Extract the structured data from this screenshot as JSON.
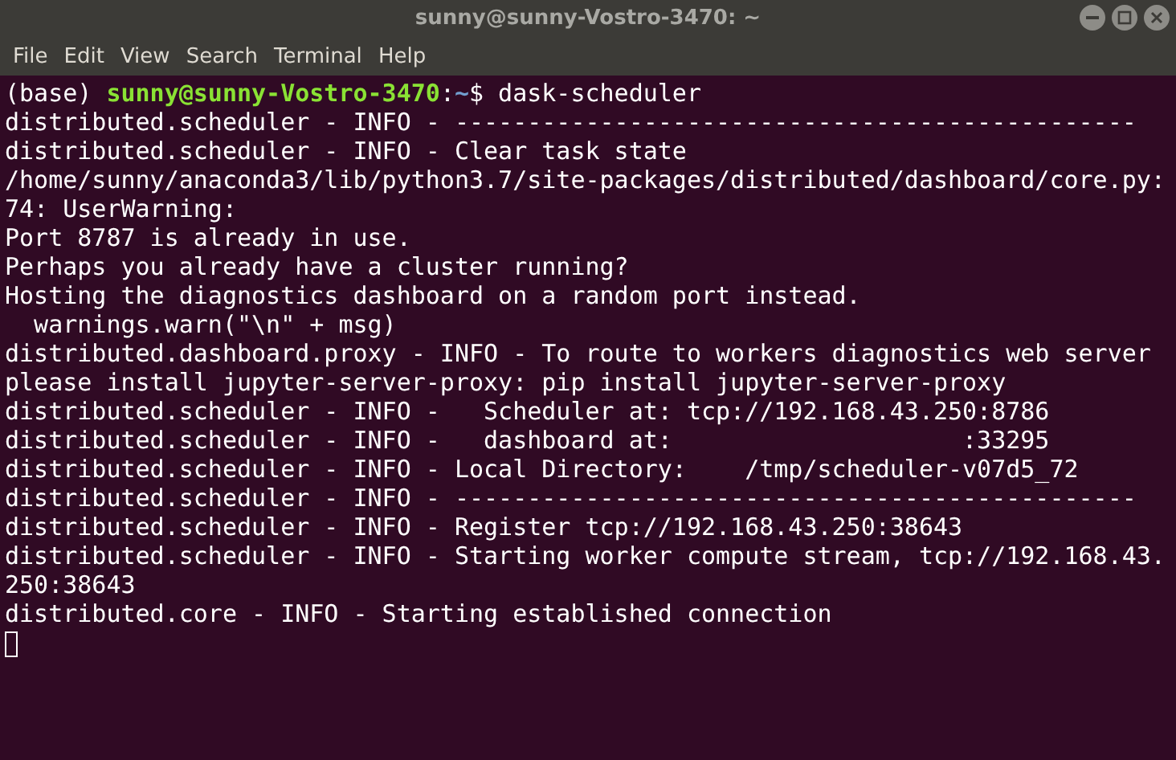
{
  "window": {
    "title": "sunny@sunny-Vostro-3470: ~"
  },
  "menu": [
    "File",
    "Edit",
    "View",
    "Search",
    "Terminal",
    "Help"
  ],
  "terminal": {
    "prompt": [
      {
        "kind": "plain",
        "text": "(base) "
      },
      {
        "kind": "user",
        "text": "sunny@sunny-Vostro-3470"
      },
      {
        "kind": "plain",
        "text": ":"
      },
      {
        "kind": "path",
        "text": "~"
      },
      {
        "kind": "plain",
        "text": "$ dask-scheduler"
      }
    ],
    "lines": [
      "distributed.scheduler - INFO - -----------------------------------------------",
      "distributed.scheduler - INFO - Clear task state",
      "/home/sunny/anaconda3/lib/python3.7/site-packages/distributed/dashboard/core.py:",
      "74: UserWarning:",
      "Port 8787 is already in use.",
      "Perhaps you already have a cluster running?",
      "Hosting the diagnostics dashboard on a random port instead.",
      "  warnings.warn(\"\\n\" + msg)",
      "distributed.dashboard.proxy - INFO - To route to workers diagnostics web server",
      "please install jupyter-server-proxy: pip install jupyter-server-proxy",
      "distributed.scheduler - INFO -   Scheduler at: tcp://192.168.43.250:8786",
      "distributed.scheduler - INFO -   dashboard at:                    :33295",
      "distributed.scheduler - INFO - Local Directory:    /tmp/scheduler-v07d5_72",
      "distributed.scheduler - INFO - -----------------------------------------------",
      "distributed.scheduler - INFO - Register tcp://192.168.43.250:38643",
      "distributed.scheduler - INFO - Starting worker compute stream, tcp://192.168.43.",
      "250:38643",
      "distributed.core - INFO - Starting established connection"
    ],
    "cursor": true
  }
}
